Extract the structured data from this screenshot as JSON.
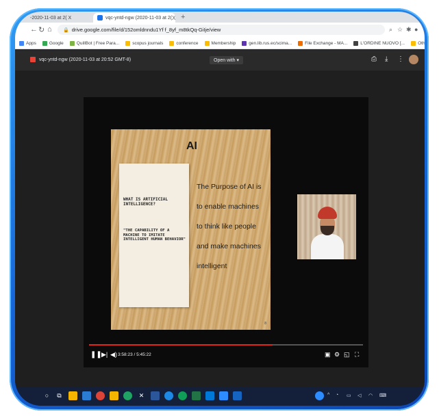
{
  "browser": {
    "tabs": [
      {
        "label": "-2020-11-03 at 2( X",
        "active": false
      },
      {
        "label": "vqc-yntd-ngw (2020-11-03 at 2(",
        "active": true
      }
    ],
    "tab_close": "X",
    "new_tab": "+",
    "url": "drive.google.com/file/d/152omldnndu1Yf f_8yf_m8tkQq-GiIje/view",
    "bookmarks": [
      {
        "label": "Apps",
        "color": "#4285f4"
      },
      {
        "label": "Google",
        "color": "#34a853"
      },
      {
        "label": "QuillBot | Free Para...",
        "color": "#7cb342"
      },
      {
        "label": "scopus journals",
        "color": "#fbbc05"
      },
      {
        "label": "conference",
        "color": "#fbbc05"
      },
      {
        "label": "Membership",
        "color": "#fbbc05"
      },
      {
        "label": "gen.lib.rus.ec/scima...",
        "color": "#5e35b1"
      },
      {
        "label": "File Exchange - MA...",
        "color": "#ef6c00"
      },
      {
        "label": "L'ORDINE NUOVO [...",
        "color": "#424242"
      },
      {
        "label": "Other bookmarks",
        "color": "#fbbc05"
      }
    ]
  },
  "viewer": {
    "file_title": "vqc-yntd-ngw (2020-11-03 at 20:52 GMT-8)",
    "open_with": "Open with ▾"
  },
  "slide": {
    "title": "AI",
    "card_question": "WHAT IS ARTIFICIAL INTELLIGENCE?",
    "card_answer": "\"THE CAPABILITY OF A MACHINE TO IMITATE INTELLIGENT HUMAN BEHAVIOR\"",
    "lines": [
      "The Purpose of AI is",
      "to enable machines",
      "to think like people",
      "and make machines",
      "intelligent"
    ],
    "page_number": "8"
  },
  "player": {
    "time": "3:58:23 / 5:45:22",
    "progress_fraction": 0.67
  },
  "colors": {
    "frame": "#1565d8",
    "progress_played": "#e0261b"
  }
}
